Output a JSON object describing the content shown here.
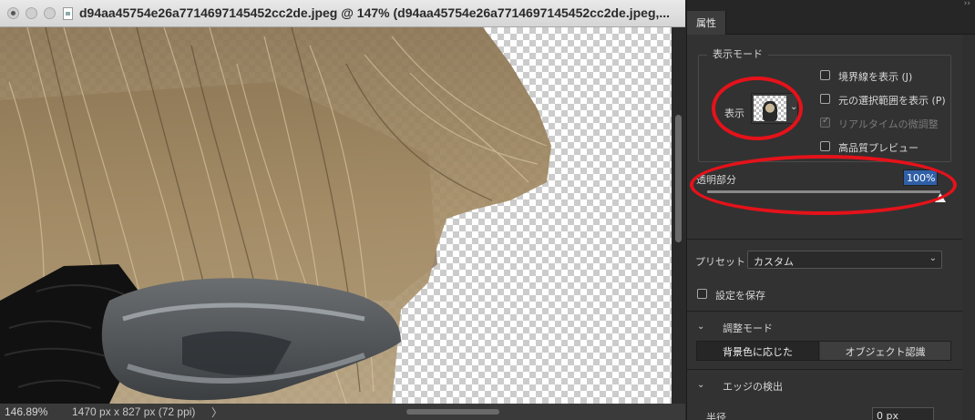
{
  "document": {
    "title": "d94aa45754e26a7714697145452cc2de.jpeg @ 147% (d94aa45754e26a7714697145452cc2de.jpeg,...",
    "zoom": "146.89%",
    "size": "1470 px x 827 px (72 ppi)",
    "status_chevron": "〉"
  },
  "panel": {
    "tab": "属性",
    "collapse_icon": "››",
    "view_mode": {
      "group_label": "表示モード",
      "view_label": "表示",
      "options": [
        {
          "label": "境界線を表示 (J)",
          "checked": false,
          "enabled": true
        },
        {
          "label": "元の選択範囲を表示 (P)",
          "checked": false,
          "enabled": true
        },
        {
          "label": "リアルタイムの微調整",
          "checked": true,
          "enabled": false
        },
        {
          "label": "高品質プレビュー",
          "checked": false,
          "enabled": true
        }
      ]
    },
    "transparency": {
      "label": "透明部分",
      "value": "100%",
      "level": 1.0
    },
    "preset": {
      "label": "プリセット",
      "value": "カスタム"
    },
    "save_settings": {
      "label": "設定を保存",
      "checked": false
    },
    "adjust_mode": {
      "header": "調整モード",
      "buttons": [
        "背景色に応じた",
        "オブジェクト認識"
      ],
      "selected": 0
    },
    "edge_detection": {
      "header": "エッジの検出",
      "radius_label": "半径",
      "radius_value": "0 px"
    }
  },
  "colors": {
    "annotation": "#e5121a",
    "highlight": "#2f5fa7"
  }
}
